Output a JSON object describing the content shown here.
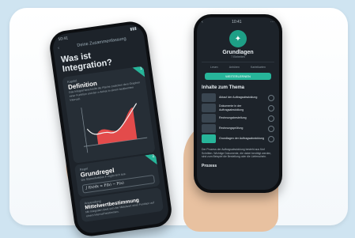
{
  "left_phone": {
    "status_time": "10:41",
    "header": "Deine Zusammenfassung",
    "heading": "Was ist Integration?",
    "sections": [
      {
        "label": "Kapitel",
        "title": "Definition",
        "corner": "1",
        "text": "Das Integral beschreibt die Fläche zwischen dem Graphen einer Funktion und der x-Achse in einem bestimmten Intervall."
      },
      {
        "label": "Regel",
        "title": "Grundregel",
        "corner": "2",
        "text": "Die Stammfunktion F ergibt sich aus:",
        "formula": "∫ f(x)dx = F(b) − F(a)"
      },
      {
        "label": "Anwendung",
        "title": "Mittelwertbestimmung",
        "text": "Mit Integralen lässt sich der Mittelwert einer Funktion auf einem Intervall bestimmen."
      }
    ],
    "accent": "#27b59a"
  },
  "right_phone": {
    "status_time": "10:41",
    "title": "Grundlagen",
    "subtitle": "7 Einheiten",
    "stats": [
      "Lesen",
      "Anhören",
      "Karteikarten"
    ],
    "cta": "WEITERLERNEN",
    "topics_heading": "Inhalte zum Thema",
    "topics": [
      {
        "label": "Ablauf der Auftragsabwicklung"
      },
      {
        "label": "Dokumente in der Auftragsabwicklung"
      },
      {
        "label": "Rechnungsbestellung"
      },
      {
        "label": "Rechnungsprüfung"
      },
      {
        "label": "Grundlagen der Auftragsabwicklung"
      }
    ],
    "description": "Der Prozess der Auftragsabwicklung besteht aus fünf Schritten. Wichtige Dokumente, die dabei benötigt werden, sind zum Beispiel die Bestellung oder die Lieferschein.",
    "section_footer": "Prozess"
  }
}
